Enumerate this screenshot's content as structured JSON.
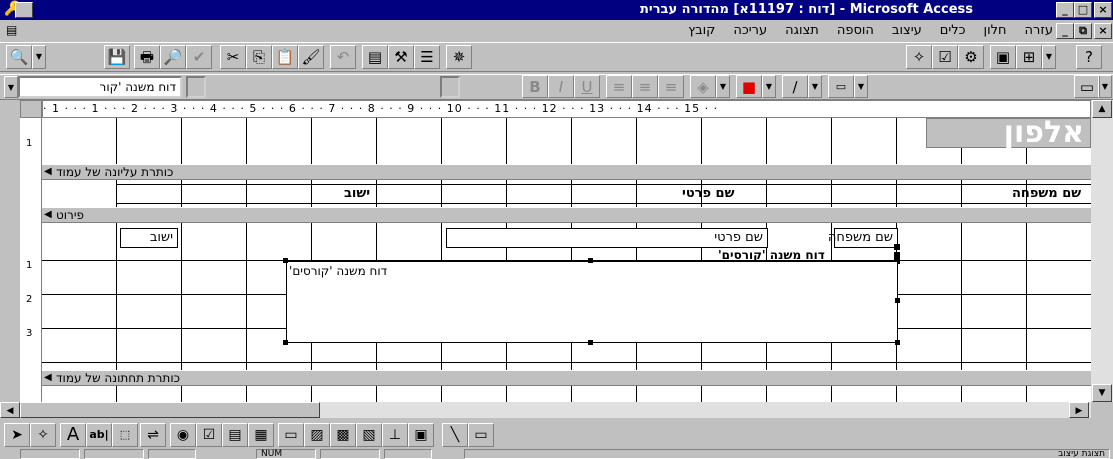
{
  "window": {
    "title": "Microsoft Access - [דוח : 11197א] מהדורה עברית",
    "controls": [
      "_",
      "□",
      "×"
    ]
  },
  "menu": {
    "items": [
      "קובץ",
      "עריכה",
      "תצוגה",
      "הוספה",
      "עיצוב",
      "כלים",
      "חלון",
      "עזרה"
    ]
  },
  "format_bar": {
    "object_combo": "דוח משנה 'קור"
  },
  "report": {
    "ruler_text": "· 1 · · · 1 · · · 2 · · · 3 · · · 4 · · · 5 · · · 6 · · · 7 · · · 8 · · · 9 · · · 10 · · · 11 · · · 12 · · · 13 · · · 14 · · · 15 · ·",
    "report_title": "אלפון",
    "sections": {
      "page_header": "כותרת עליונה של עמוד",
      "detail": "פירוט",
      "page_footer": "כותרת תחתונה של עמוד"
    },
    "header_labels": {
      "last_name": "שם משפחה",
      "first_name": "שם פרטי",
      "city": "ישוב"
    },
    "detail_fields": {
      "last_name": "שם משפחה",
      "first_name": "שם פרטי",
      "city": "ישוב"
    },
    "subreport_label": "דוח משנה 'קורסים'",
    "subreport_control": "'דוח משנה 'קורסים"
  },
  "status": {
    "left": "תצוגת עיצוב",
    "num": "NUM"
  }
}
